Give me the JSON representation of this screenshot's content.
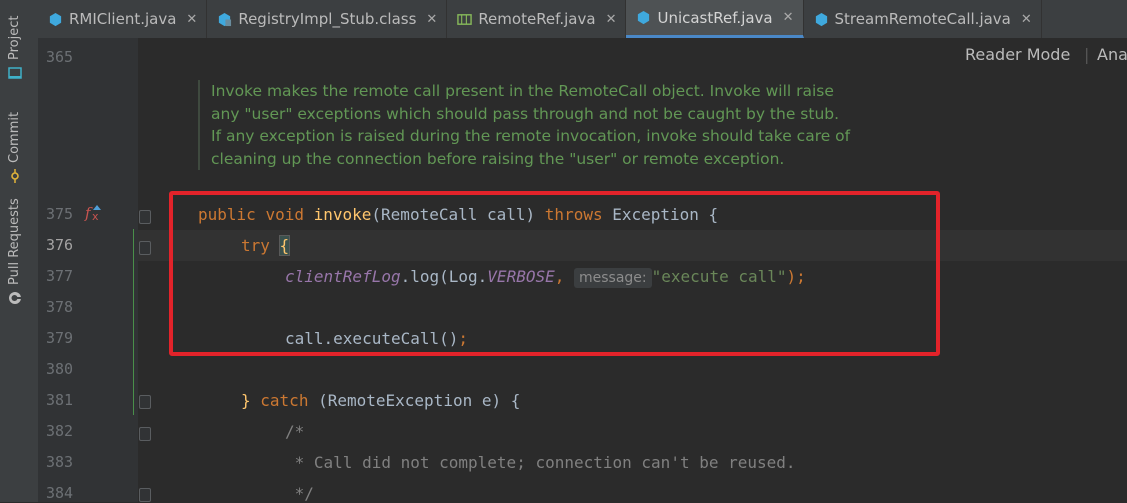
{
  "sidebar": {
    "tools": [
      {
        "label": "Project",
        "icon": "folder-icon"
      },
      {
        "label": "Commit",
        "icon": "commit-icon"
      },
      {
        "label": "Pull Requests",
        "icon": "github-icon"
      }
    ]
  },
  "tabs": [
    {
      "label": "RMIClient.java",
      "icon": "java-class-icon",
      "active": false
    },
    {
      "label": "RegistryImpl_Stub.class",
      "icon": "class-file-icon",
      "active": false
    },
    {
      "label": "RemoteRef.java",
      "icon": "interface-icon",
      "active": false
    },
    {
      "label": "UnicastRef.java",
      "icon": "java-class-icon",
      "active": true
    },
    {
      "label": "StreamRemoteCall.java",
      "icon": "java-class-icon",
      "active": false
    }
  ],
  "toolbar": {
    "reader_mode": "Reader Mode",
    "analyze": "Ana"
  },
  "doc_comment": "Invoke makes the remote call present in the RemoteCall object. Invoke will raise any \"user\" exceptions which should pass through and not be caught by the stub. If any exception is raised during the remote invocation, invoke should take care of cleaning up the connection before raising the \"user\" or remote exception.",
  "line_numbers": {
    "l365": "365",
    "l375": "375",
    "l376": "376",
    "l377": "377",
    "l378": "378",
    "l379": "379",
    "l380": "380",
    "l381": "381",
    "l382": "382",
    "l383": "383",
    "l384": "384"
  },
  "code": {
    "l375": {
      "kw1": "public",
      "kw2": "void",
      "name": "invoke",
      "params": "(RemoteCall call) ",
      "kw3": "throws",
      "rest": " Exception {"
    },
    "l376": {
      "kw": "try",
      "brace": "{"
    },
    "l377": {
      "field": "clientRefLog",
      "mid": ".log(Log.",
      "const": "VERBOSE",
      "comma": ", ",
      "hint": "message:",
      "str": "\"execute call\"",
      "end": ");"
    },
    "l379": {
      "text": "call.executeCall()",
      "end": ";"
    },
    "l381": {
      "brace": "}",
      "kw": "catch",
      "rest": " (RemoteException e) {"
    },
    "l382": {
      "text": "/*"
    },
    "l383": {
      "text": " * Call did not complete; connection can't be reused."
    },
    "l384": {
      "text": " */"
    }
  },
  "colors": {
    "highlight_box": "#e2232a",
    "active_tab_underline": "#4a88c7"
  }
}
